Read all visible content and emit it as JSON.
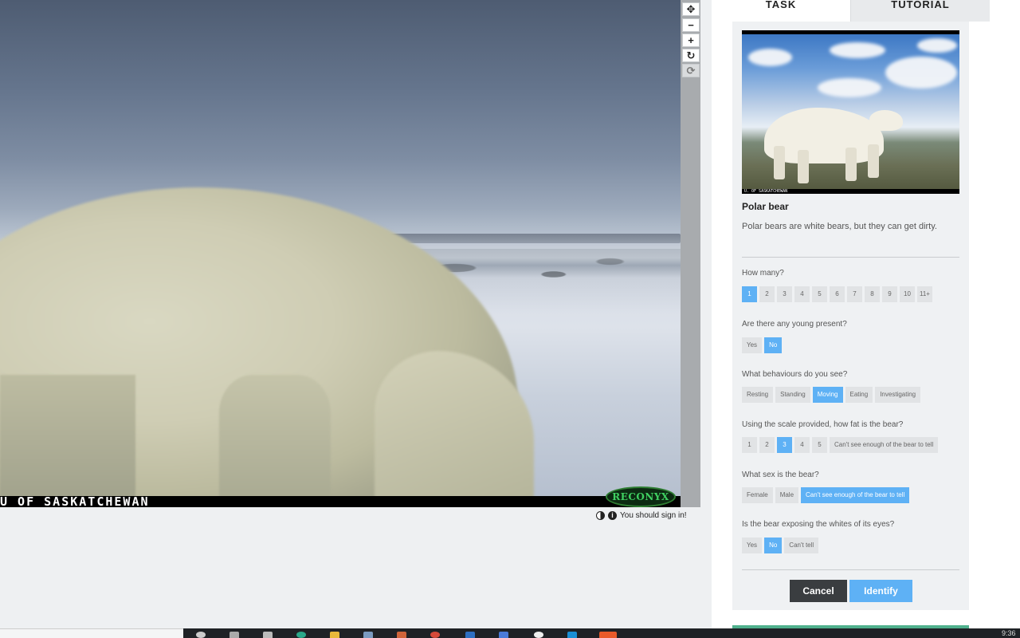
{
  "viewer": {
    "caption": "U OF SASKATCHEWAN",
    "camera_brand": "RECONYX",
    "toolbar": [
      {
        "name": "move-icon",
        "glyph": "✥",
        "disabled": false
      },
      {
        "name": "zoom-out-icon",
        "glyph": "−",
        "disabled": false
      },
      {
        "name": "zoom-in-icon",
        "glyph": "+",
        "disabled": false
      },
      {
        "name": "rotate-icon",
        "glyph": "↻",
        "disabled": false
      },
      {
        "name": "reset-icon",
        "glyph": "⟳",
        "disabled": true
      }
    ],
    "sign_in_note": "You should sign in!"
  },
  "tabs": {
    "task": "TASK",
    "tutorial": "TUTORIAL"
  },
  "species": {
    "thumbnail_caption": "U. OF SASKATCHEWAN",
    "name": "Polar bear",
    "description": "Polar bears are white bears, but they can get dirty."
  },
  "questions": [
    {
      "label": "How many?",
      "options": [
        "1",
        "2",
        "3",
        "4",
        "5",
        "6",
        "7",
        "8",
        "9",
        "10",
        "11+"
      ],
      "selected": "1"
    },
    {
      "label": "Are there any young present?",
      "options": [
        "Yes",
        "No"
      ],
      "selected": "No"
    },
    {
      "label": "What behaviours do you see?",
      "options": [
        "Resting",
        "Standing",
        "Moving",
        "Eating",
        "Investigating"
      ],
      "selected": "Moving"
    },
    {
      "label": "Using the scale provided, how fat is the bear?",
      "options": [
        "1",
        "2",
        "3",
        "4",
        "5",
        "Can't see enough of the bear to tell"
      ],
      "selected": "3"
    },
    {
      "label": "What sex is the bear?",
      "options": [
        "Female",
        "Male",
        "Can't see enough of the bear to tell"
      ],
      "selected": "Can't see enough of the bear to tell"
    },
    {
      "label": "Is the bear exposing the whites of its eyes?",
      "options": [
        "Yes",
        "No",
        "Can't tell"
      ],
      "selected": "No"
    }
  ],
  "actions": {
    "cancel": "Cancel",
    "identify": "Identify"
  },
  "taskbar": {
    "clock": "9:36"
  },
  "colors": {
    "selected_answer": "#5eb1f5",
    "cancel_button": "#3a3d40",
    "identify_button": "#5eb1f5"
  }
}
